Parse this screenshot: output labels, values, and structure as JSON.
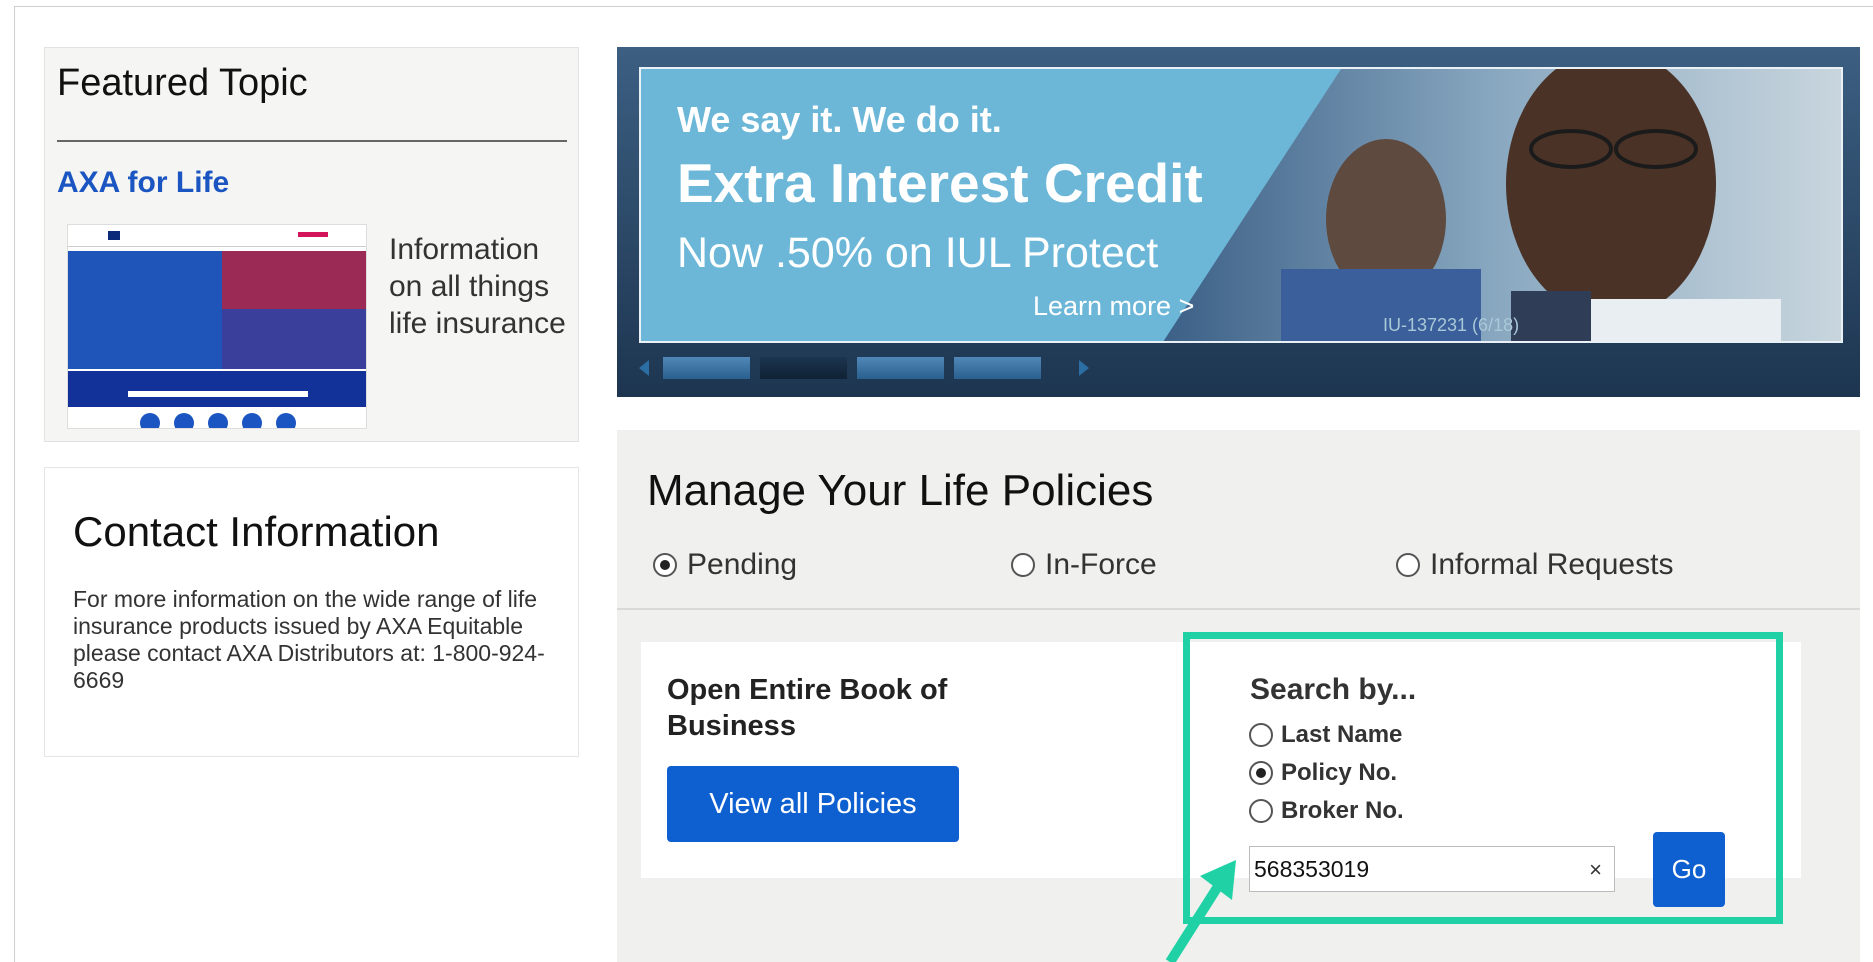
{
  "featured": {
    "title": "Featured Topic",
    "link_label": "AXA for Life",
    "description": "Information on all things life insurance"
  },
  "contact": {
    "title": "Contact Information",
    "text": "For more information on the wide range of life insurance products issued by AXA Equitable please contact AXA Distributors at: 1-800-924-6669"
  },
  "banner": {
    "tagline": "We say it. We do it.",
    "headline": "Extra Interest Credit",
    "subhead": "Now .50% on IUL Protect",
    "cta": "Learn more >",
    "code": "IU-137231 (6/18)",
    "slides": 4,
    "active_slide": 2
  },
  "manage": {
    "title": "Manage Your Life Policies",
    "status_options": [
      {
        "label": "Pending",
        "checked": true
      },
      {
        "label": "In-Force",
        "checked": false
      },
      {
        "label": "Informal Requests",
        "checked": false
      }
    ],
    "book_title": "Open Entire Book of Business",
    "view_button": "View all Policies",
    "search": {
      "title": "Search by...",
      "options": [
        {
          "label": "Last Name",
          "checked": false
        },
        {
          "label": "Policy No.",
          "checked": true
        },
        {
          "label": "Broker No.",
          "checked": false
        }
      ],
      "value": "568353019",
      "clear": "×",
      "go": "Go"
    }
  },
  "colors": {
    "accent_blue": "#0e5fcf",
    "link_blue": "#1a55c2",
    "highlight": "#1fd1a5",
    "banner_sky": "#6cb7d8"
  },
  "icons": {
    "carousel_prev": "triangle-left-icon",
    "carousel_next": "triangle-right-icon",
    "clear": "close-icon",
    "annotation": "arrow-icon"
  }
}
